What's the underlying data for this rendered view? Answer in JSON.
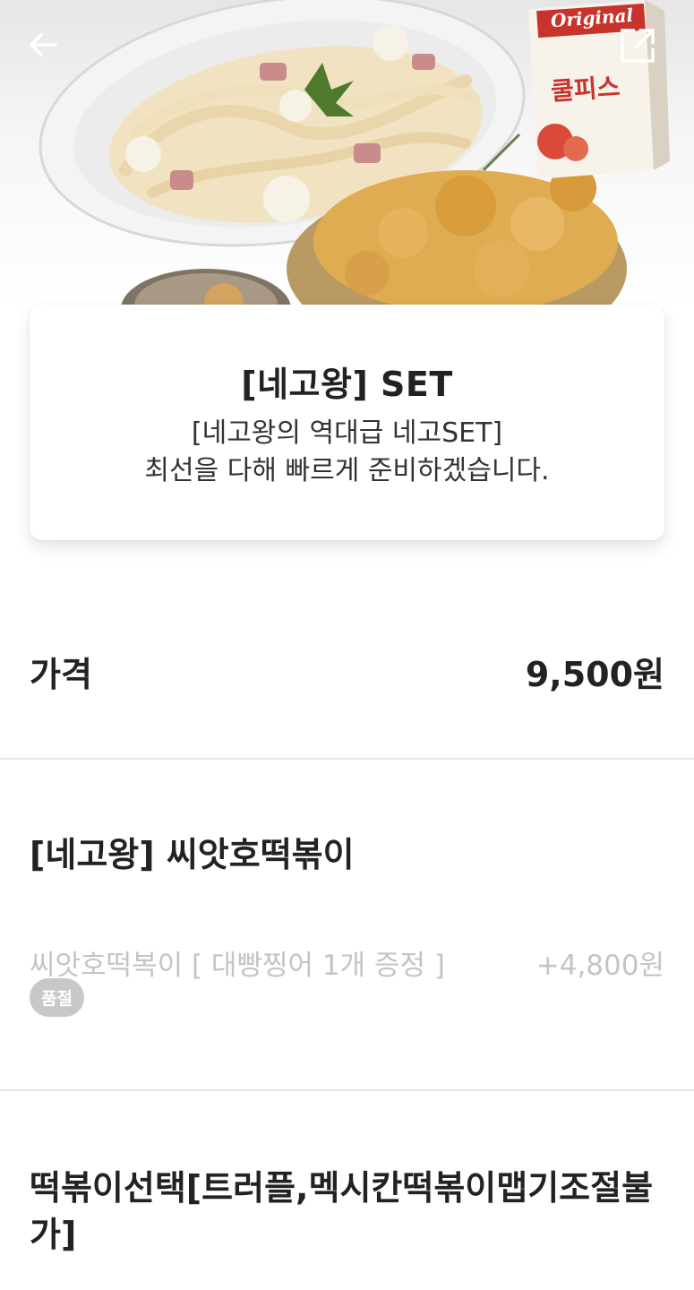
{
  "header": {
    "back_icon": "arrow-left-icon",
    "share_icon": "external-share-icon"
  },
  "hero": {
    "drink_brand": "Original",
    "drink_name": "쿨피스"
  },
  "menu": {
    "title": "[네고왕] SET",
    "description_line1": "[네고왕의 역대급 네고SET]",
    "description_line2": "최선을 다해 빠르게 준비하겠습니다."
  },
  "price": {
    "label": "가격",
    "value": "9,500원"
  },
  "option_groups": [
    {
      "title": "[네고왕] 씨앗호떡볶이",
      "options": [
        {
          "name": "씨앗호떡복이 [ 대빵찡어 1개 증정 ]",
          "price": "+4,800원",
          "badge": "품절"
        }
      ]
    },
    {
      "title": "떡볶이선택[트러플,멕시칸떡볶이맵기조절불가]"
    }
  ],
  "colors": {
    "text_primary": "#222222",
    "text_disabled": "#c4c4c4",
    "badge_bg": "#c8c8c8",
    "divider": "#e6e6e6"
  }
}
